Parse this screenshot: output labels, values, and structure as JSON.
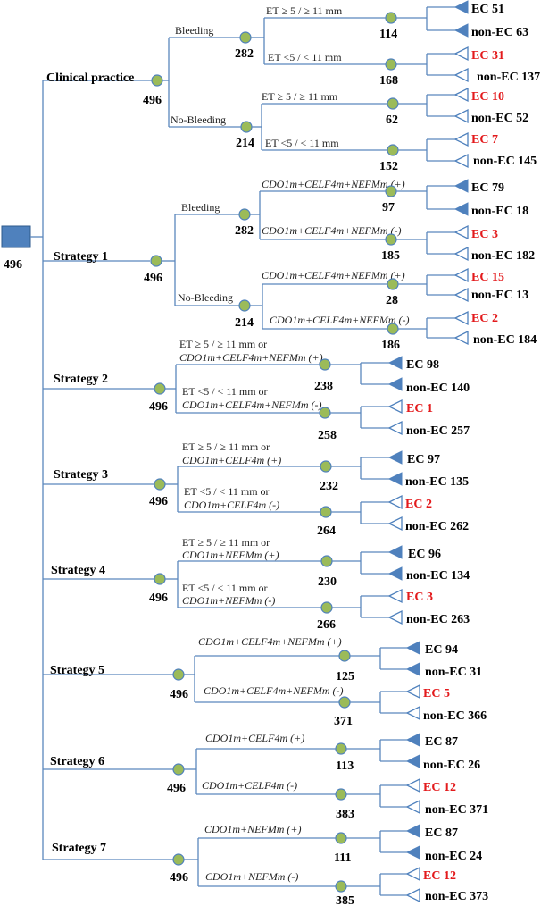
{
  "root": {
    "n": "496"
  },
  "strategies": [
    {
      "name": "Clinical practice",
      "n": "496",
      "branches": [
        {
          "label": "Bleeding",
          "n": "282",
          "children": [
            {
              "label": "ET ≥ 5 / ≥ 11 mm",
              "n": "114",
              "outcomes": [
                {
                  "label": "EC 51",
                  "red": false,
                  "filled": true
                },
                {
                  "label": "non-EC 63",
                  "red": false,
                  "filled": true
                }
              ]
            },
            {
              "label": "ET <5 / < 11 mm",
              "n": "168",
              "outcomes": [
                {
                  "label": "EC 31",
                  "red": true,
                  "filled": false
                },
                {
                  "label": "non-EC 137",
                  "red": false,
                  "filled": false
                }
              ]
            }
          ]
        },
        {
          "label": "No-Bleeding",
          "n": "214",
          "children": [
            {
              "label": "ET ≥ 5 / ≥ 11 mm",
              "n": "62",
              "outcomes": [
                {
                  "label": "EC 10",
                  "red": true,
                  "filled": false
                },
                {
                  "label": "non-EC 52",
                  "red": false,
                  "filled": false
                }
              ]
            },
            {
              "label": "ET <5 / < 11 mm",
              "n": "152",
              "outcomes": [
                {
                  "label": "EC 7",
                  "red": true,
                  "filled": false
                },
                {
                  "label": "non-EC 145",
                  "red": false,
                  "filled": false
                }
              ]
            }
          ]
        }
      ]
    },
    {
      "name": "Strategy 1",
      "n": "496",
      "branches": [
        {
          "label": "Bleeding",
          "n": "282",
          "children": [
            {
              "label": "CDO1m+CELF4m+NEFMm (+)",
              "n": "97",
              "outcomes": [
                {
                  "label": "EC 79",
                  "red": false,
                  "filled": true
                },
                {
                  "label": "non-EC 18",
                  "red": false,
                  "filled": true
                }
              ]
            },
            {
              "label": "CDO1m+CELF4m+NEFMm (-)",
              "n": "185",
              "outcomes": [
                {
                  "label": "EC 3",
                  "red": true,
                  "filled": false
                },
                {
                  "label": "non-EC 182",
                  "red": false,
                  "filled": false
                }
              ]
            }
          ]
        },
        {
          "label": "No-Bleeding",
          "n": "214",
          "children": [
            {
              "label": "CDO1m+CELF4m+NEFMm (+)",
              "n": "28",
              "outcomes": [
                {
                  "label": "EC 15",
                  "red": true,
                  "filled": false
                },
                {
                  "label": "non-EC 13",
                  "red": false,
                  "filled": false
                }
              ]
            },
            {
              "label": "CDO1m+CELF4m+NEFMm (-)",
              "n": "186",
              "outcomes": [
                {
                  "label": "EC 2",
                  "red": true,
                  "filled": false
                },
                {
                  "label": "non-EC 184",
                  "red": false,
                  "filled": false
                }
              ]
            }
          ]
        }
      ]
    },
    {
      "name": "Strategy 2",
      "n": "496",
      "children": [
        {
          "label1": "ET ≥ 5 / ≥ 11 mm or",
          "label2": "CDO1m+CELF4m+NEFMm (+)",
          "n": "238",
          "outcomes": [
            {
              "label": "EC 98",
              "red": false,
              "filled": true
            },
            {
              "label": "non-EC 140",
              "red": false,
              "filled": true
            }
          ]
        },
        {
          "label1": "ET <5 / < 11 mm or",
          "label2": "CDO1m+CELF4m+NEFMm (-)",
          "n": "258",
          "outcomes": [
            {
              "label": "EC 1",
              "red": true,
              "filled": false
            },
            {
              "label": "non-EC 257",
              "red": false,
              "filled": false
            }
          ]
        }
      ]
    },
    {
      "name": "Strategy 3",
      "n": "496",
      "children": [
        {
          "label1": "ET ≥ 5 / ≥ 11 mm or",
          "label2": "CDO1m+CELF4m (+)",
          "n": "232",
          "outcomes": [
            {
              "label": "EC 97",
              "red": false,
              "filled": true
            },
            {
              "label": "non-EC 135",
              "red": false,
              "filled": true
            }
          ]
        },
        {
          "label1": "ET <5 / < 11 mm or",
          "label2": "CDO1m+CELF4m (-)",
          "n": "264",
          "outcomes": [
            {
              "label": "EC 2",
              "red": true,
              "filled": false
            },
            {
              "label": "non-EC 262",
              "red": false,
              "filled": false
            }
          ]
        }
      ]
    },
    {
      "name": "Strategy 4",
      "n": "496",
      "children": [
        {
          "label1": "ET ≥ 5 / ≥ 11 mm or",
          "label2": "CDO1m+NEFMm (+)",
          "n": "230",
          "outcomes": [
            {
              "label": "EC 96",
              "red": false,
              "filled": true
            },
            {
              "label": "non-EC 134",
              "red": false,
              "filled": true
            }
          ]
        },
        {
          "label1": "ET <5 / < 11 mm or",
          "label2": "CDO1m+NEFMm (-)",
          "n": "266",
          "outcomes": [
            {
              "label": "EC 3",
              "red": true,
              "filled": false
            },
            {
              "label": "non-EC 263",
              "red": false,
              "filled": false
            }
          ]
        }
      ]
    },
    {
      "name": "Strategy 5",
      "n": "496",
      "children": [
        {
          "label": "CDO1m+CELF4m+NEFMm (+)",
          "n": "125",
          "outcomes": [
            {
              "label": "EC 94",
              "red": false,
              "filled": true
            },
            {
              "label": "non-EC 31",
              "red": false,
              "filled": true
            }
          ]
        },
        {
          "label": "CDO1m+CELF4m+NEFMm (-)",
          "n": "371",
          "outcomes": [
            {
              "label": "EC 5",
              "red": true,
              "filled": false
            },
            {
              "label": "non-EC 366",
              "red": false,
              "filled": false
            }
          ]
        }
      ]
    },
    {
      "name": "Strategy 6",
      "n": "496",
      "children": [
        {
          "label": "CDO1m+CELF4m (+)",
          "n": "113",
          "outcomes": [
            {
              "label": "EC 87",
              "red": false,
              "filled": true
            },
            {
              "label": "non-EC 26",
              "red": false,
              "filled": true
            }
          ]
        },
        {
          "label": "CDO1m+CELF4m (-)",
          "n": "383",
          "outcomes": [
            {
              "label": "EC 12",
              "red": true,
              "filled": false
            },
            {
              "label": "non-EC 371",
              "red": false,
              "filled": false
            }
          ]
        }
      ]
    },
    {
      "name": "Strategy 7",
      "n": "496",
      "children": [
        {
          "label": "CDO1m+NEFMm (+)",
          "n": "111",
          "outcomes": [
            {
              "label": "EC 87",
              "red": false,
              "filled": true
            },
            {
              "label": "non-EC 24",
              "red": false,
              "filled": true
            }
          ]
        },
        {
          "label": "CDO1m+NEFMm (-)",
          "n": "385",
          "outcomes": [
            {
              "label": "EC 12",
              "red": true,
              "filled": false
            },
            {
              "label": "non-EC 373",
              "red": false,
              "filled": false
            }
          ]
        }
      ]
    }
  ]
}
